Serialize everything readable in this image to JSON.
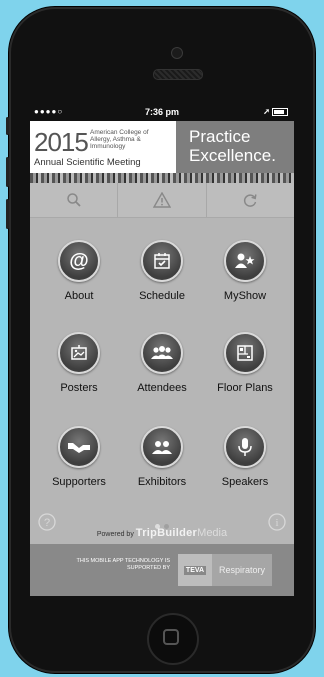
{
  "status_bar": {
    "signal": "●●●●○",
    "time": "7:36 pm"
  },
  "banner": {
    "year": "2015",
    "college": "American College of Allergy, Asthma & Immunology",
    "meeting": "Annual Scientific Meeting",
    "tagline_line1": "Practice",
    "tagline_line2": "Excellence."
  },
  "toolbar": {
    "icons": [
      "search-icon",
      "alert-icon",
      "refresh-icon"
    ]
  },
  "tiles": [
    {
      "label": "About",
      "icon": "at-icon"
    },
    {
      "label": "Schedule",
      "icon": "calendar-icon"
    },
    {
      "label": "MyShow",
      "icon": "user-star-icon"
    },
    {
      "label": "Posters",
      "icon": "poster-icon"
    },
    {
      "label": "Attendees",
      "icon": "people-icon"
    },
    {
      "label": "Floor Plans",
      "icon": "floorplan-icon"
    },
    {
      "label": "Supporters",
      "icon": "handshake-icon"
    },
    {
      "label": "Exhibitors",
      "icon": "exhibitors-icon"
    },
    {
      "label": "Speakers",
      "icon": "microphone-icon"
    }
  ],
  "footer": {
    "powered_prefix": "Powered by",
    "brand_a": "TripBuilder",
    "brand_b": "Media",
    "sponsor_text": "THIS MOBILE APP TECHNOLOGY IS SUPPORTED BY",
    "sponsor_logo_a": "TEVA",
    "sponsor_logo_b": "Respiratory"
  },
  "colors": {
    "background": "#7fd3ec",
    "screen": "#b6b6b6",
    "icon": "#4a4a4a"
  }
}
